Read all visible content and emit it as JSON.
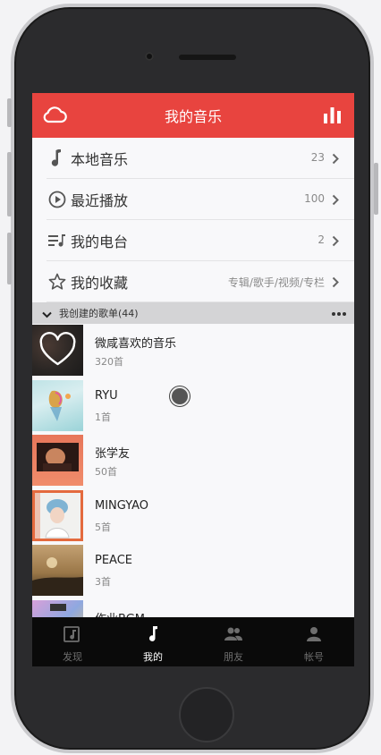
{
  "header": {
    "title": "我的音乐",
    "accent": "#e8443f"
  },
  "menu": [
    {
      "label": "本地音乐",
      "count": "23",
      "icon": "music-note-icon"
    },
    {
      "label": "最近播放",
      "count": "100",
      "icon": "play-circle-icon"
    },
    {
      "label": "我的电台",
      "count": "2",
      "icon": "radio-list-icon"
    },
    {
      "label": "我的收藏",
      "count": "专辑/歌手/视频/专栏",
      "icon": "star-icon"
    }
  ],
  "section": {
    "title": "我创建的歌单(44)"
  },
  "playlists": [
    {
      "name": "微咸喜欢的音乐",
      "count": "320首"
    },
    {
      "name": "RYU",
      "count": "1首"
    },
    {
      "name": "张学友",
      "count": "50首"
    },
    {
      "name": "MINGYAO",
      "count": "5首"
    },
    {
      "name": "PEACE",
      "count": "3首"
    },
    {
      "name": "作业BGM",
      "count": ""
    }
  ],
  "tabs": [
    {
      "label": "发现",
      "icon": "discover-icon",
      "active": false
    },
    {
      "label": "我的",
      "icon": "music-note-icon",
      "active": true
    },
    {
      "label": "朋友",
      "icon": "friends-icon",
      "active": false
    },
    {
      "label": "帐号",
      "icon": "account-icon",
      "active": false
    }
  ]
}
